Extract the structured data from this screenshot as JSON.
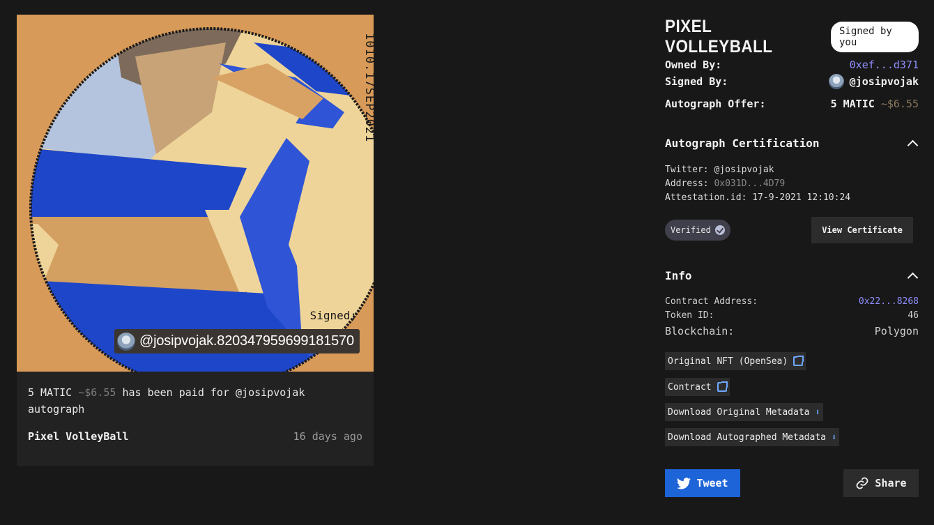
{
  "nft_image": {
    "stamp_text": "1010.17SEP2021",
    "signed_label": "Signed:",
    "signature_text": "@josipvojak.820347959699181570"
  },
  "card": {
    "paid_amount": "5 MATIC",
    "paid_usd": "~$6.55",
    "paid_rest": "has been paid for @josipvojak autograph",
    "title": "Pixel VolleyBall",
    "time": "16 days ago"
  },
  "header": {
    "title": "PIXEL VOLLEYBALL",
    "badge": "Signed by you"
  },
  "summary": {
    "owned_by_label": "Owned By:",
    "owned_by_value": "0xef...d371",
    "signed_by_label": "Signed By:",
    "signed_by_value": "@josipvojak",
    "offer_label": "Autograph Offer:",
    "offer_amount": "5 MATIC",
    "offer_usd": "~$6.55"
  },
  "certification": {
    "heading": "Autograph Certification",
    "twitter_label": "Twitter:",
    "twitter_value": "@josipvojak",
    "address_label": "Address:",
    "address_value": "0x031D...4D79",
    "attestation_label": "Attestation.id:",
    "attestation_value": "17-9-2021 12:10:24",
    "verified_label": "Verified",
    "view_certificate": "View Certificate"
  },
  "info": {
    "heading": "Info",
    "contract_label": "Contract Address:",
    "contract_value": "0x22...8268",
    "token_label": "Token ID:",
    "token_value": "46",
    "chain_label": "Blockchain:",
    "chain_value": "Polygon",
    "links": [
      {
        "label": "Original NFT (OpenSea)",
        "icon": "external-link-icon"
      },
      {
        "label": "Contract",
        "icon": "external-link-icon"
      },
      {
        "label": "Download Original Metadata",
        "icon": "download-icon"
      },
      {
        "label": "Download Autographed Metadata",
        "icon": "download-icon"
      }
    ]
  },
  "actions": {
    "tweet": "Tweet",
    "share": "Share"
  },
  "colors": {
    "background": "#181818",
    "accent_link": "#8f8fff",
    "tweet_blue": "#1d64d8",
    "ball_blue": "#1e46c8",
    "ball_cream": "#eed498",
    "ball_orange_bg": "#d89a58"
  }
}
